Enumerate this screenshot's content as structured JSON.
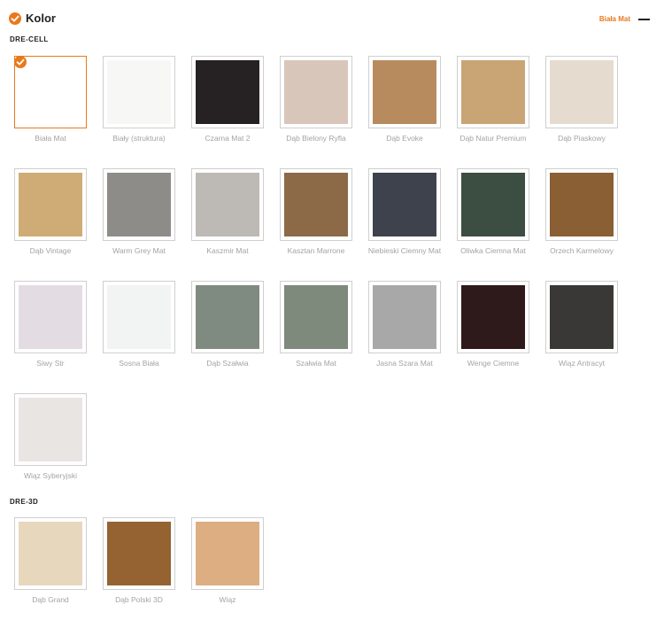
{
  "header": {
    "title": "Kolor",
    "selected_value": "Biała Mat"
  },
  "accent_color": "#e8791d",
  "sections": [
    {
      "title": "DRE-CELL",
      "swatches": [
        {
          "label": "Biała Mat",
          "color": "#ffffff",
          "selected": true
        },
        {
          "label": "Biały (struktura)",
          "color": "#f7f7f6",
          "selected": false
        },
        {
          "label": "Czarna Mat 2",
          "color": "#262224",
          "selected": false
        },
        {
          "label": "Dąb Bielony Ryfla",
          "color": "#d9c6bb",
          "selected": false
        },
        {
          "label": "Dąb Evoke",
          "color": "#b88b5e",
          "selected": false
        },
        {
          "label": "Dąb Natur Premium",
          "color": "#c9a575",
          "selected": false
        },
        {
          "label": "Dąb Piaskowy",
          "color": "#e6dbcf",
          "selected": false
        },
        {
          "label": "Dąb Vintage",
          "color": "#cfac75",
          "selected": false
        },
        {
          "label": "Warm Grey Mat",
          "color": "#8e8c89",
          "selected": false
        },
        {
          "label": "Kaszmir Mat",
          "color": "#bdb9b4",
          "selected": false
        },
        {
          "label": "Kasztan Marrone",
          "color": "#8c6947",
          "selected": false
        },
        {
          "label": "Niebieski Ciemny Mat",
          "color": "#3d424c",
          "selected": false
        },
        {
          "label": "Oliwka Ciemna Mat",
          "color": "#3c4d42",
          "selected": false
        },
        {
          "label": "Orzech Karmelowy",
          "color": "#8a5f34",
          "selected": false
        },
        {
          "label": "Siwy Str",
          "color": "#e3dde3",
          "selected": false
        },
        {
          "label": "Sosna Biała",
          "color": "#f2f4f3",
          "selected": false
        },
        {
          "label": "Dąb Szałwia",
          "color": "#7f8b80",
          "selected": false
        },
        {
          "label": "Szałwia Mat",
          "color": "#7d8a7c",
          "selected": false
        },
        {
          "label": "Jasna Szara Mat",
          "color": "#a8a8a9",
          "selected": false
        },
        {
          "label": "Wenge Ciemne",
          "color": "#2e1a1b",
          "selected": false
        },
        {
          "label": "Wiąz Antracyt",
          "color": "#3a3836",
          "selected": false
        },
        {
          "label": "Wiąz Syberyjski",
          "color": "#e9e5e3",
          "selected": false
        }
      ]
    },
    {
      "title": "DRE-3D",
      "swatches": [
        {
          "label": "Dąb Grand",
          "color": "#e7d7bd",
          "selected": false
        },
        {
          "label": "Dąb Polski 3D",
          "color": "#946331",
          "selected": false
        },
        {
          "label": "Wiąz",
          "color": "#dcae82",
          "selected": false
        }
      ]
    }
  ]
}
